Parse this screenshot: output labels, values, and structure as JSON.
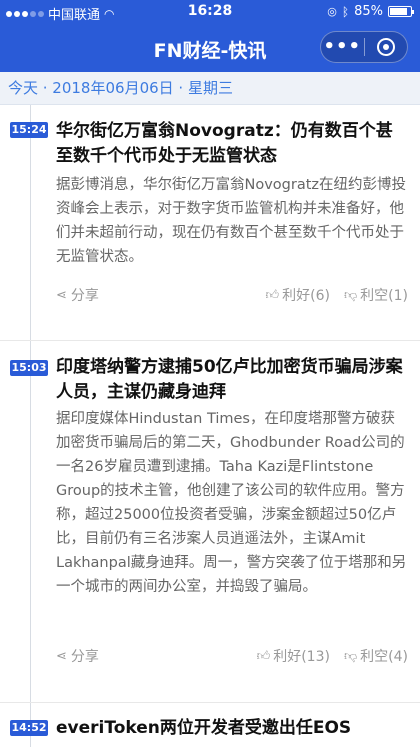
{
  "status_bar": {
    "carrier": "中国联通",
    "time": "16:28",
    "battery": "85%",
    "battery_level": 0.85
  },
  "nav": {
    "title": "FN财经-快讯",
    "more_icon": "more-dots-icon",
    "close_icon": "mini-program-close-icon"
  },
  "date_header": "今天 · 2018年06月06日 · 星期三",
  "news": [
    {
      "time": "15:24",
      "title": "华尔街亿万富翁Novogratz：仍有数百个甚至数千个代币处于无监管状态",
      "summary": "据彭博消息，华尔街亿万富翁Novogratz在纽约彭博投资峰会上表示，对于数字货币监管机构并未准备好，他们并未超前行动，现在仍有数百个甚至数千个代币处于无监管状态。",
      "share": "分享",
      "like": "利好(6)",
      "bearish": "利空(1)"
    },
    {
      "time": "15:03",
      "title": "印度塔纳警方逮捕50亿卢比加密货币骗局涉案人员，主谋仍藏身迪拜",
      "summary": "据印度媒体Hindustan Times，在印度塔那警方破获加密货币骗局后的第二天，Ghodbunder Road公司的一名26岁雇员遭到逮捕。Taha Kazi是Flintstone Group的技术主管，他创建了该公司的软件应用。警方称，超过25000位投资者受骗，涉案金额超过50亿卢比，目前仍有三名涉案人员逍遥法外，主谋Amit Lakhanpal藏身迪拜。周一，警方突袭了位于塔那和另一个城市的两间办公室，并捣毁了骗局。",
      "share": "分享",
      "like": "利好(13)",
      "bearish": "利空(4)"
    },
    {
      "time": "14:52",
      "title": "everiToken两位开发者受邀出任EOS"
    }
  ],
  "colors": {
    "brand": "#2a5bd7",
    "date_text": "#3d7be0",
    "summary_text": "#666666"
  }
}
